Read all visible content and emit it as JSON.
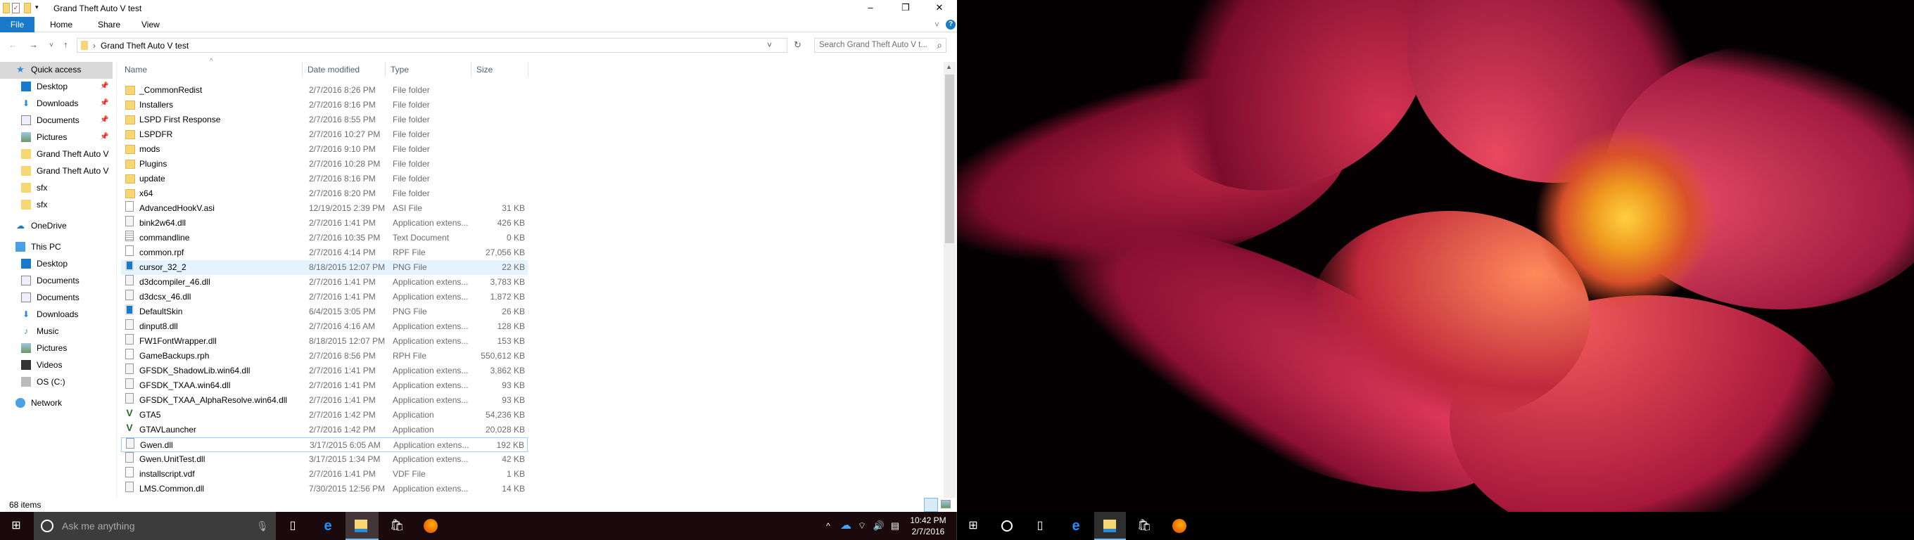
{
  "window": {
    "title": "Grand Theft Auto V test",
    "minimize": "–",
    "maximize": "❐",
    "close": "✕"
  },
  "ribbon": {
    "file": "File",
    "tabs": [
      "Home",
      "Share",
      "View"
    ],
    "expand": "˅",
    "help": "?"
  },
  "address": {
    "path": "Grand Theft Auto V test",
    "separator": "›",
    "back": "←",
    "forward": "→",
    "recent": "˅",
    "up": "↑",
    "dropdown": "˅",
    "refresh": "↻",
    "search_placeholder": "Search Grand Theft Auto V t...",
    "search_icon": "⌕"
  },
  "sidebar": [
    {
      "label": "Quick access",
      "icon": "star-icon",
      "indent": 1,
      "sel": true
    },
    {
      "label": "Desktop",
      "icon": "desktop-icon",
      "indent": 2,
      "pin": true
    },
    {
      "label": "Downloads",
      "icon": "downloads-icon",
      "indent": 2,
      "pin": true
    },
    {
      "label": "Documents",
      "icon": "documents-icon",
      "indent": 2,
      "pin": true
    },
    {
      "label": "Pictures",
      "icon": "pictures-icon",
      "indent": 2,
      "pin": true
    },
    {
      "label": "Grand Theft Auto V",
      "icon": "folder-icon",
      "indent": 2
    },
    {
      "label": "Grand Theft Auto V",
      "icon": "folder-icon",
      "indent": 2
    },
    {
      "label": "sfx",
      "icon": "folder-icon",
      "indent": 2
    },
    {
      "label": "sfx",
      "icon": "folder-icon",
      "indent": 2
    },
    {
      "label": "OneDrive",
      "icon": "onedrive-icon",
      "indent": 1,
      "gap": true
    },
    {
      "label": "This PC",
      "icon": "pc-icon",
      "indent": 1,
      "gap": true
    },
    {
      "label": "Desktop",
      "icon": "desktop-icon",
      "indent": 2
    },
    {
      "label": "Documents",
      "icon": "documents-icon",
      "indent": 2
    },
    {
      "label": "Documents",
      "icon": "documents-icon",
      "indent": 2
    },
    {
      "label": "Downloads",
      "icon": "downloads-icon",
      "indent": 2
    },
    {
      "label": "Music",
      "icon": "music-icon",
      "indent": 2
    },
    {
      "label": "Pictures",
      "icon": "pictures-icon",
      "indent": 2
    },
    {
      "label": "Videos",
      "icon": "videos-icon",
      "indent": 2
    },
    {
      "label": "OS (C:)",
      "icon": "drive-icon",
      "indent": 2
    },
    {
      "label": "Network",
      "icon": "network-icon",
      "indent": 1,
      "gap": true
    }
  ],
  "columns": {
    "name": "Name",
    "date": "Date modified",
    "type": "Type",
    "size": "Size",
    "sort_caret": "^"
  },
  "files": [
    {
      "name": "_CommonRedist",
      "date": "2/7/2016 8:26 PM",
      "type": "File folder",
      "size": "",
      "icon": "folder"
    },
    {
      "name": "Installers",
      "date": "2/7/2016 8:16 PM",
      "type": "File folder",
      "size": "",
      "icon": "folder"
    },
    {
      "name": "LSPD First Response",
      "date": "2/7/2016 8:55 PM",
      "type": "File folder",
      "size": "",
      "icon": "folder"
    },
    {
      "name": "LSPDFR",
      "date": "2/7/2016 10:27 PM",
      "type": "File folder",
      "size": "",
      "icon": "folder"
    },
    {
      "name": "mods",
      "date": "2/7/2016 9:10 PM",
      "type": "File folder",
      "size": "",
      "icon": "folder"
    },
    {
      "name": "Plugins",
      "date": "2/7/2016 10:28 PM",
      "type": "File folder",
      "size": "",
      "icon": "folder"
    },
    {
      "name": "update",
      "date": "2/7/2016 8:16 PM",
      "type": "File folder",
      "size": "",
      "icon": "folder"
    },
    {
      "name": "x64",
      "date": "2/7/2016 8:20 PM",
      "type": "File folder",
      "size": "",
      "icon": "folder"
    },
    {
      "name": "AdvancedHookV.asi",
      "date": "12/19/2015 2:39 PM",
      "type": "ASI File",
      "size": "31 KB",
      "icon": "file"
    },
    {
      "name": "bink2w64.dll",
      "date": "2/7/2016 1:41 PM",
      "type": "Application extens...",
      "size": "426 KB",
      "icon": "dll"
    },
    {
      "name": "commandline",
      "date": "2/7/2016 10:35 PM",
      "type": "Text Document",
      "size": "0 KB",
      "icon": "text"
    },
    {
      "name": "common.rpf",
      "date": "2/7/2016 4:14 PM",
      "type": "RPF File",
      "size": "27,056 KB",
      "icon": "file"
    },
    {
      "name": "cursor_32_2",
      "date": "8/18/2015 12:07 PM",
      "type": "PNG File",
      "size": "22 KB",
      "icon": "png",
      "state": "sel"
    },
    {
      "name": "d3dcompiler_46.dll",
      "date": "2/7/2016 1:41 PM",
      "type": "Application extens...",
      "size": "3,783 KB",
      "icon": "dll"
    },
    {
      "name": "d3dcsx_46.dll",
      "date": "2/7/2016 1:41 PM",
      "type": "Application extens...",
      "size": "1,872 KB",
      "icon": "dll"
    },
    {
      "name": "DefaultSkin",
      "date": "6/4/2015 3:05 PM",
      "type": "PNG File",
      "size": "26 KB",
      "icon": "png"
    },
    {
      "name": "dinput8.dll",
      "date": "2/7/2016 4:16 AM",
      "type": "Application extens...",
      "size": "128 KB",
      "icon": "dll"
    },
    {
      "name": "FW1FontWrapper.dll",
      "date": "8/18/2015 12:07 PM",
      "type": "Application extens...",
      "size": "153 KB",
      "icon": "dll"
    },
    {
      "name": "GameBackups.rph",
      "date": "2/7/2016 8:56 PM",
      "type": "RPH File",
      "size": "550,612 KB",
      "icon": "file"
    },
    {
      "name": "GFSDK_ShadowLib.win64.dll",
      "date": "2/7/2016 1:41 PM",
      "type": "Application extens...",
      "size": "3,862 KB",
      "icon": "dll"
    },
    {
      "name": "GFSDK_TXAA.win64.dll",
      "date": "2/7/2016 1:41 PM",
      "type": "Application extens...",
      "size": "93 KB",
      "icon": "dll"
    },
    {
      "name": "GFSDK_TXAA_AlphaResolve.win64.dll",
      "date": "2/7/2016 1:41 PM",
      "type": "Application extens...",
      "size": "93 KB",
      "icon": "dll"
    },
    {
      "name": "GTA5",
      "date": "2/7/2016 1:42 PM",
      "type": "Application",
      "size": "54,236 KB",
      "icon": "gta"
    },
    {
      "name": "GTAVLauncher",
      "date": "2/7/2016 1:42 PM",
      "type": "Application",
      "size": "20,028 KB",
      "icon": "gta"
    },
    {
      "name": "Gwen.dll",
      "date": "3/17/2015 6:05 AM",
      "type": "Application extens...",
      "size": "192 KB",
      "icon": "dll",
      "state": "focus"
    },
    {
      "name": "Gwen.UnitTest.dll",
      "date": "3/17/2015 1:34 PM",
      "type": "Application extens...",
      "size": "42 KB",
      "icon": "dll"
    },
    {
      "name": "installscript.vdf",
      "date": "2/7/2016 1:41 PM",
      "type": "VDF File",
      "size": "1 KB",
      "icon": "file"
    },
    {
      "name": "LMS.Common.dll",
      "date": "7/30/2015 12:56 PM",
      "type": "Application extens...",
      "size": "14 KB",
      "icon": "dll"
    }
  ],
  "status": {
    "items": "68 items"
  },
  "taskbar": {
    "search_placeholder": "Ask me anything",
    "time": "10:42 PM",
    "date": "2/7/2016",
    "tray_up": "^"
  },
  "colors": {
    "accent": "#1979ca",
    "selection": "#e5f3ff",
    "focus": "#99d1ff",
    "folder": "#f7d674"
  }
}
